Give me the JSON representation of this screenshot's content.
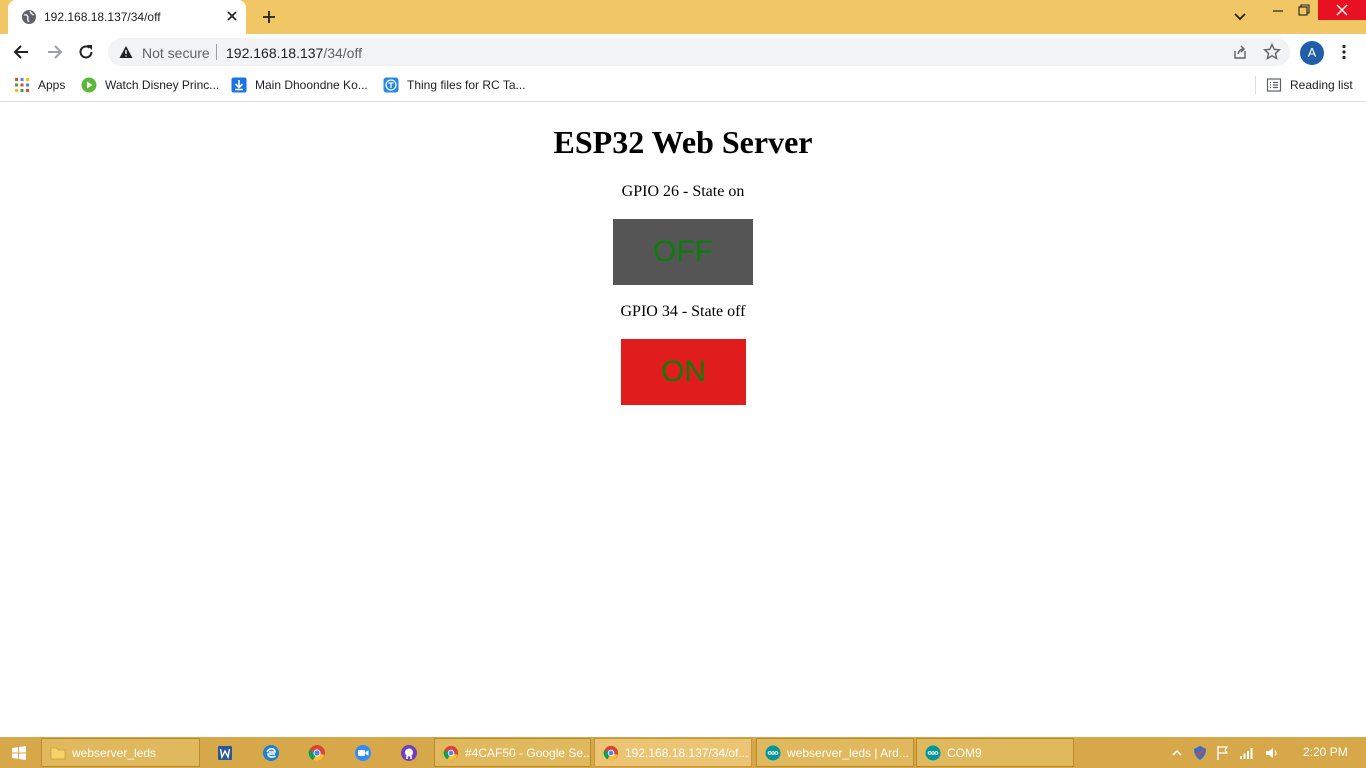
{
  "browser": {
    "tab": {
      "title": "192.168.18.137/34/off"
    },
    "omnibox": {
      "security_label": "Not secure",
      "url_host": "192.168.18.137",
      "url_path": "/34/off"
    },
    "profile_initial": "A",
    "bookmarks": [
      {
        "label": "Apps",
        "icon": "apps-grid-icon"
      },
      {
        "label": "Watch Disney Princ...",
        "icon": "play-icon"
      },
      {
        "label": "Main Dhoondne Ko...",
        "icon": "download-icon"
      },
      {
        "label": "Thing files for RC Ta...",
        "icon": "thing-icon"
      }
    ],
    "reading_list_label": "Reading list"
  },
  "page": {
    "title": "ESP32 Web Server",
    "gpio": [
      {
        "state_text": "GPIO 26 - State on",
        "button_label": "OFF",
        "button_color": "#555555"
      },
      {
        "state_text": "GPIO 34 - State off",
        "button_label": "ON",
        "button_color": "#e01c1c"
      }
    ]
  },
  "taskbar": {
    "items": [
      {
        "label": "webserver_leds",
        "icon": "folder-icon"
      },
      {
        "label": "#4CAF50 - Google Se...",
        "icon": "chrome-icon"
      },
      {
        "label": "192.168.18.137/34/of...",
        "icon": "chrome-icon"
      },
      {
        "label": "webserver_leds | Ard...",
        "icon": "arduino-icon"
      },
      {
        "label": "COM9",
        "icon": "arduino-icon"
      }
    ],
    "clock": "2:20 PM"
  },
  "colors": {
    "tabstrip": "#f1c765",
    "taskbar": "#d6a84a",
    "button_text": "#0b7d0b"
  }
}
